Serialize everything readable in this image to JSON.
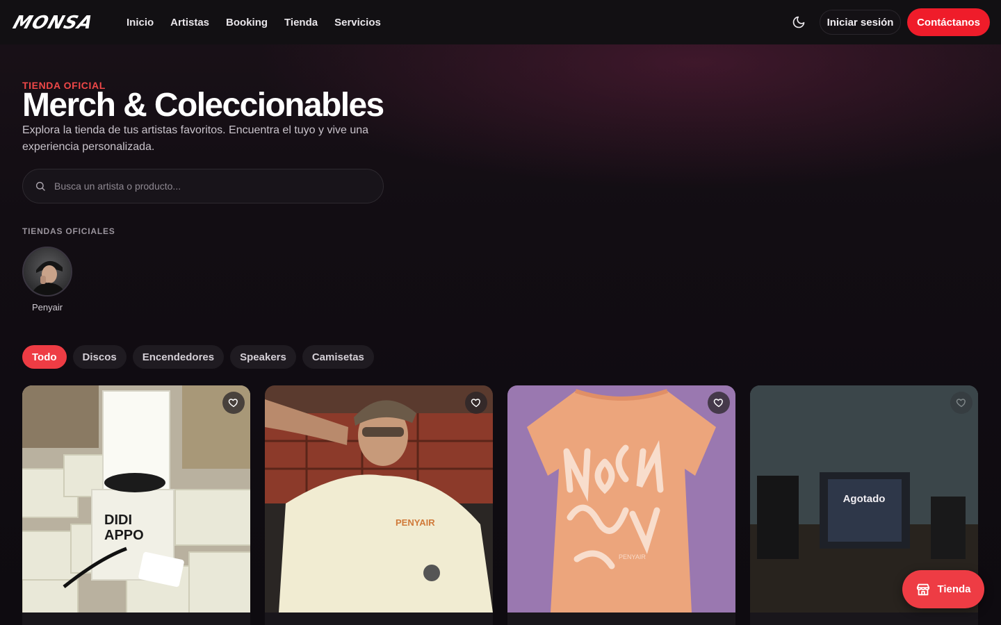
{
  "brand": {
    "logo_text": "MONSA",
    "accent": "#ef1c2a"
  },
  "nav": {
    "items": [
      "Inicio",
      "Artistas",
      "Booking",
      "Tienda",
      "Servicios"
    ]
  },
  "header": {
    "theme_icon": "moon-icon",
    "login_label": "Iniciar sesión",
    "contact_label": "Contáctanos"
  },
  "hero": {
    "eyebrow": "TIENDA OFICIAL",
    "title": "Merch & Coleccionables",
    "subtitle": "Explora la tienda de tus artistas favoritos. Encuentra el tuyo y vive una experiencia personalizada."
  },
  "search": {
    "placeholder": "Busca un artista o producto..."
  },
  "stores": {
    "label": "TIENDAS OFICIALES",
    "items": [
      {
        "name": "Penyair"
      }
    ]
  },
  "filters": {
    "items": [
      "Todo",
      "Discos",
      "Encendedores",
      "Speakers",
      "Camisetas"
    ],
    "active": "Todo"
  },
  "products": [
    {
      "status": "",
      "favorite_icon": "heart-icon"
    },
    {
      "status": "",
      "favorite_icon": "heart-icon"
    },
    {
      "status": "",
      "favorite_icon": "heart-icon"
    },
    {
      "status": "Agotado",
      "favorite_icon": "heart-icon"
    }
  ],
  "float_button": {
    "label": "Tienda",
    "icon": "store-icon"
  }
}
